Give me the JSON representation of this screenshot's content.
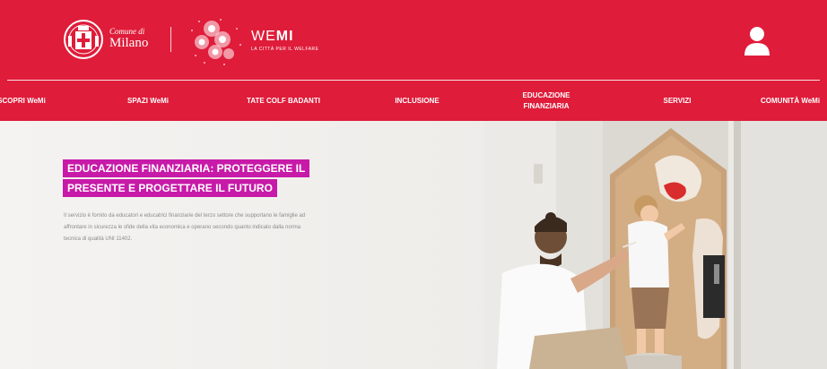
{
  "header": {
    "comune_small": "Comune di",
    "comune_name": "Milano",
    "wemi_light": "WE",
    "wemi_bold": "MI",
    "wemi_tagline": "LA CITTÀ PER IL WELFARE",
    "user_icon": "user-icon"
  },
  "nav": {
    "items": [
      {
        "label": "SCOPRI WeMi"
      },
      {
        "label": "SPAZI WeMi"
      },
      {
        "label": "TATE COLF BADANTI"
      },
      {
        "label": "INCLUSIONE"
      },
      {
        "label": "EDUCAZIONE\nFINANZIARIA"
      },
      {
        "label": "SERVIZI"
      },
      {
        "label": "COMUNITÀ WeMi"
      }
    ]
  },
  "hero": {
    "title_line1": "EDUCAZIONE FINANZIARIA: PROTEGGERE IL",
    "title_line2": "PRESENTE E PROGETTARE IL FUTURO",
    "description": "Il servizio è fornito da educatori e educatrici finanziarie del terzo settore che supportano le famiglie ad affrontare in sicurezza le sfide della vita economica e operano secondo quanto indicato dalla norma tecnica di qualità UNI 11402."
  },
  "colors": {
    "brand_red": "#df1c3a",
    "title_highlight": "#c71aa8"
  }
}
